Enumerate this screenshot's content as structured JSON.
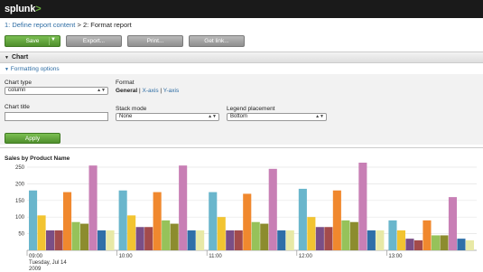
{
  "app": {
    "logo_text": "splunk",
    "logo_suffix": ">"
  },
  "breadcrumb": {
    "step1": "1: Define report content",
    "sep": " > ",
    "step2": "2: Format report"
  },
  "toolbar": {
    "save": "Save",
    "export": "Export...",
    "print": "Print...",
    "getlink": "Get link..."
  },
  "section": {
    "title": "Chart",
    "formatting_link": "Formatting options"
  },
  "form": {
    "chart_type_label": "Chart type",
    "chart_type_value": "column",
    "chart_title_label": "Chart title",
    "chart_title_value": "",
    "format_label": "Format",
    "tab_general": "General",
    "tab_sep": " | ",
    "tab_xaxis": "X-axis",
    "tab_yaxis": "Y-axis",
    "stack_label": "Stack mode",
    "stack_value": "None",
    "legend_label": "Legend placement",
    "legend_value": "Bottom",
    "apply": "Apply"
  },
  "colors": {
    "accent_green": "#5a9e35",
    "link_blue": "#2e6da4",
    "series": [
      "#6ab6cc",
      "#f2c431",
      "#7a4f86",
      "#a34b4b",
      "#f0882e",
      "#96c25a",
      "#8c8c2e",
      "#c87fb5",
      "#2f6fa8",
      "#e8e9a6"
    ]
  },
  "chart_data": {
    "type": "bar",
    "title": "Sales by Product Name",
    "ylim": [
      0,
      250
    ],
    "yticks": [
      "250",
      "200",
      "150",
      "100",
      "50"
    ],
    "categories": [
      "09:00",
      "10:00",
      "11:00",
      "12:00",
      "13:00"
    ],
    "x_sub": [
      "Tuesday, Jul 14",
      "2009"
    ],
    "values": [
      [
        180,
        105,
        60,
        60,
        175,
        85,
        80,
        255,
        60,
        60
      ],
      [
        180,
        105,
        70,
        70,
        175,
        90,
        80,
        255,
        60,
        60
      ],
      [
        175,
        100,
        60,
        60,
        170,
        85,
        80,
        245,
        60,
        60
      ],
      [
        185,
        100,
        70,
        70,
        180,
        90,
        85,
        265,
        60,
        60
      ],
      [
        90,
        60,
        35,
        30,
        90,
        45,
        45,
        160,
        35,
        30
      ]
    ]
  }
}
